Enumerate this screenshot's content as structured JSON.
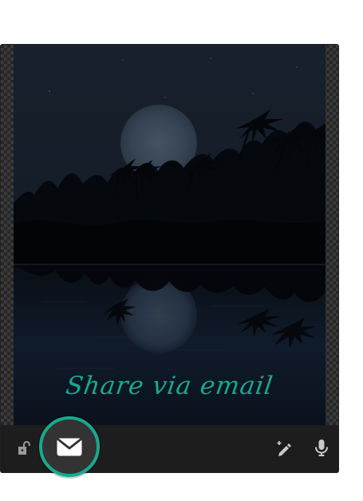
{
  "overlay": {
    "share_text": "Share via email"
  },
  "icons": {
    "lock": "lock-open-icon",
    "edit": "magic-pen-icon",
    "mic": "microphone-icon",
    "email": "mail-icon"
  },
  "colors": {
    "accent": "#19a98d",
    "toolbar": "#1d1d1d",
    "fab": "#333333"
  }
}
